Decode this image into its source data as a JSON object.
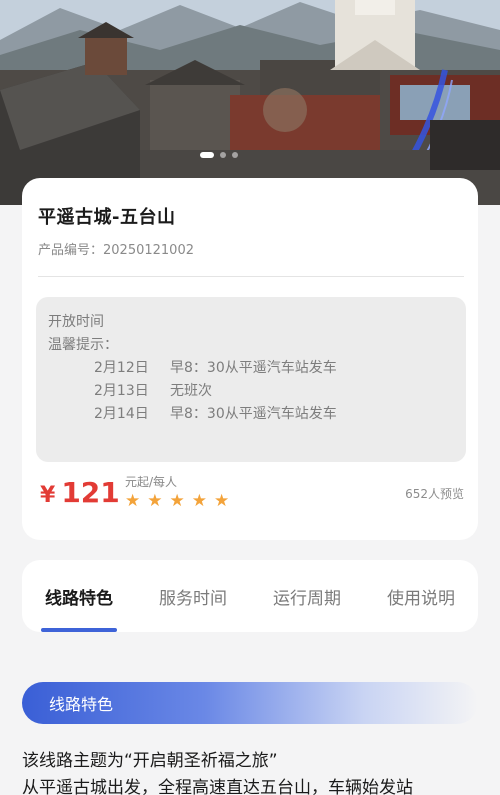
{
  "product": {
    "title": "平遥古城-五台山",
    "product_no": "产品编号：20250121002"
  },
  "notice": {
    "open_time_label": "开放时间",
    "tip_label": "温馨提示：",
    "schedule": [
      {
        "date": "2月12日",
        "info": "早8：30从平遥汽车站发车"
      },
      {
        "date": "2月13日",
        "info": "无班次"
      },
      {
        "date": "2月14日",
        "info": "早8：30从平遥汽车站发车"
      }
    ]
  },
  "price": {
    "currency": "¥",
    "amount": "121",
    "unit": "元起/每人",
    "rating": 5,
    "star_color": "#f3a33a",
    "booked": "652人预览"
  },
  "tabs": [
    {
      "label": "线路特色",
      "active": true
    },
    {
      "label": "服务时间",
      "active": false
    },
    {
      "label": "运行周期",
      "active": false
    },
    {
      "label": "使用说明",
      "active": false
    }
  ],
  "section": {
    "title": "线路特色",
    "line1": "该线路主题为“开启朝圣祈福之旅”",
    "line2": "从平遥古城出发，全程高速直达五台山，车辆始发站"
  },
  "colors": {
    "accent": "#3e63d8",
    "price": "#e23b35"
  }
}
